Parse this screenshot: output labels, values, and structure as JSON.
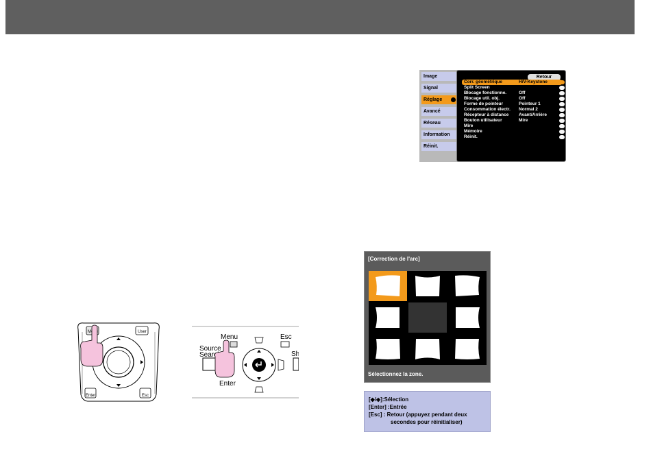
{
  "menu": {
    "tabs": [
      "Image",
      "Signal",
      "Réglage",
      "Avancé",
      "Réseau",
      "Information",
      "Réinit."
    ],
    "active_tab": "Réglage",
    "back_label": "Retour",
    "rows": [
      {
        "label": "Corr. géométrique",
        "value": "H/V-Keystone"
      },
      {
        "label": "Split Screen",
        "value": ""
      },
      {
        "label": "Blocage fonctionne.",
        "value": "Off"
      },
      {
        "label": "Blocage util. obj.",
        "value": "Off"
      },
      {
        "label": "Forme de pointeur",
        "value": "Pointeur 1"
      },
      {
        "label": "Consommation électr.",
        "value": "Normal 2"
      },
      {
        "label": "Récepteur à distance",
        "value": "Avant/Arrière"
      },
      {
        "label": "Bouton utilisateur",
        "value": "Mire"
      },
      {
        "label": "Mire",
        "value": ""
      },
      {
        "label": "Mémoire",
        "value": ""
      },
      {
        "label": "Réinit.",
        "value": ""
      }
    ]
  },
  "arc": {
    "title": "[Correction de l'arc]",
    "footer": "Sélectionnez la zone."
  },
  "help": {
    "line1": "[◆/◈]:Sélection",
    "line2": "[Enter] :Entrée",
    "line3": "[Esc] : Retour (appuyez pendant deux",
    "line4": "secondes pour réinitialiser)"
  },
  "remote": {
    "menu": "Menu",
    "user": "User",
    "enter": "Enter",
    "esc": "Esc"
  },
  "control_panel": {
    "menu": "Menu",
    "esc": "Esc",
    "source": "Source",
    "search": "Search",
    "enter": "Enter",
    "sh": "Sh"
  },
  "colors": {
    "accent": "#f39a1b",
    "header": "#5f5f5f",
    "help_bg": "#bec2e6"
  }
}
